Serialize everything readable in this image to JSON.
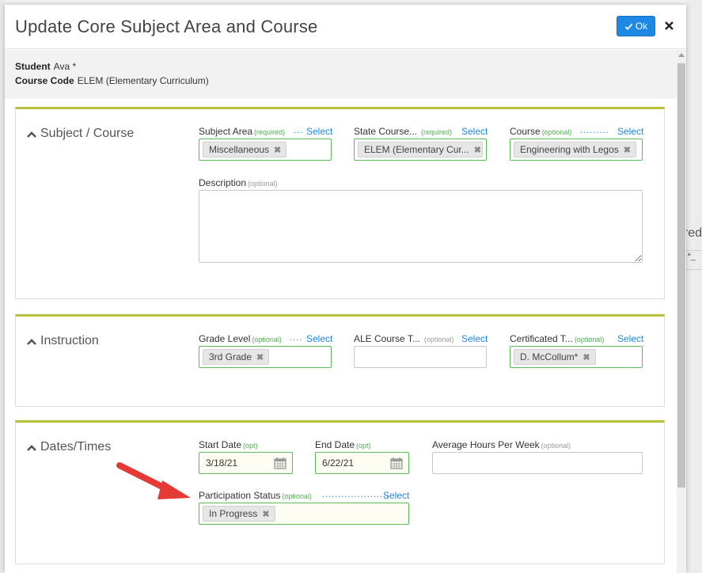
{
  "modal": {
    "title": "Update Core Subject Area and Course",
    "ok_label": "Ok"
  },
  "student": {
    "student_label": "Student",
    "student_value": "Ava *",
    "course_code_label": "Course Code",
    "course_code_value": "ELEM (Elementary Curriculum)"
  },
  "background": {
    "text_red": "red",
    "text_star": "*_"
  },
  "sections": {
    "subject_course": {
      "title": "Subject / Course",
      "subject_area": {
        "label": "Subject Area",
        "hint": "(required)",
        "select": "Select",
        "value": "Miscellaneous"
      },
      "state_course": {
        "label": "State Course...",
        "hint": "(required)",
        "select": "Select",
        "value": "ELEM (Elementary Cur..."
      },
      "course": {
        "label": "Course",
        "hint": "(optional)",
        "select": "Select",
        "value": "Engineering with Legos"
      },
      "description": {
        "label": "Description",
        "hint": "(optional)",
        "value": ""
      }
    },
    "instruction": {
      "title": "Instruction",
      "grade_level": {
        "label": "Grade Level",
        "hint": "(optional)",
        "select": "Select",
        "value": "3rd Grade"
      },
      "ale_course": {
        "label": "ALE Course T...",
        "hint": "(optional)",
        "select": "Select",
        "value": ""
      },
      "certificated": {
        "label": "Certificated T...",
        "hint": "(optional)",
        "select": "Select",
        "value": "D. McCollum*"
      }
    },
    "dates_times": {
      "title": "Dates/Times",
      "start_date": {
        "label": "Start Date",
        "hint": "(opt)",
        "value": "3/18/21"
      },
      "end_date": {
        "label": "End Date",
        "hint": "(opt)",
        "value": "6/22/21"
      },
      "avg_hours": {
        "label": "Average Hours Per Week",
        "hint": "(optional)",
        "value": ""
      },
      "participation": {
        "label": "Participation Status",
        "hint": "(optional)",
        "select": "Select",
        "value": "In Progress"
      }
    }
  },
  "colors": {
    "accent": "#1e88e5",
    "panel_border": "#b8c03a",
    "valid_border": "#5cb85c",
    "arrow": "#e53935"
  }
}
